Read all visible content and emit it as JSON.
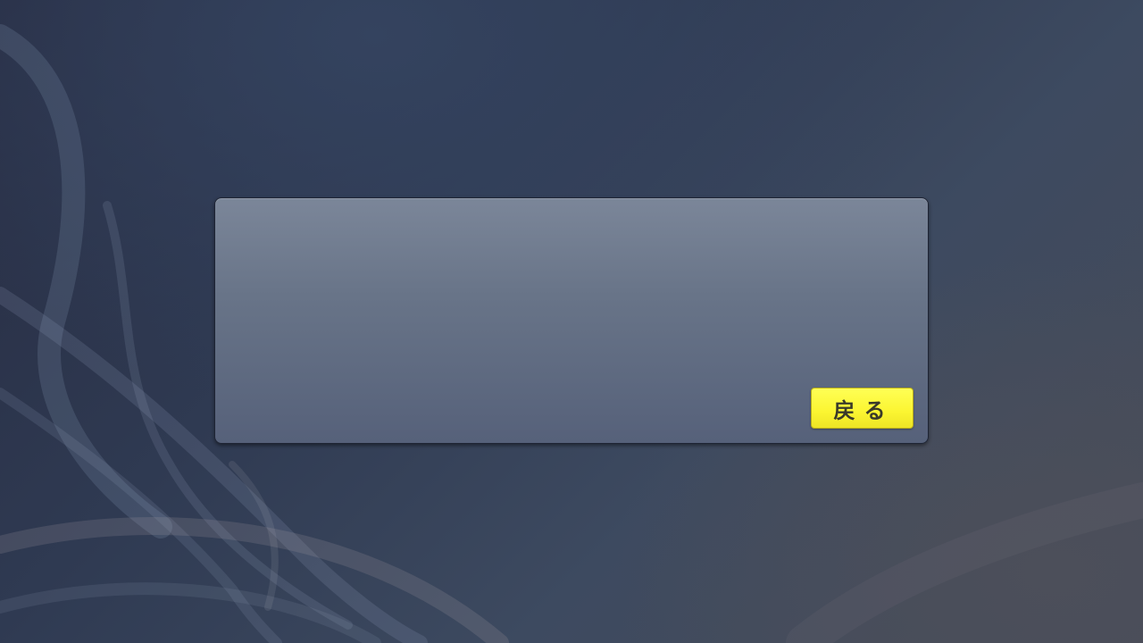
{
  "dialog": {
    "message": "",
    "back_button_label": "戻る"
  },
  "colors": {
    "button_yellow": "#fbf531",
    "button_text": "#3a3a2a",
    "panel_top": "#7b8699",
    "panel_bottom": "#56617a"
  }
}
